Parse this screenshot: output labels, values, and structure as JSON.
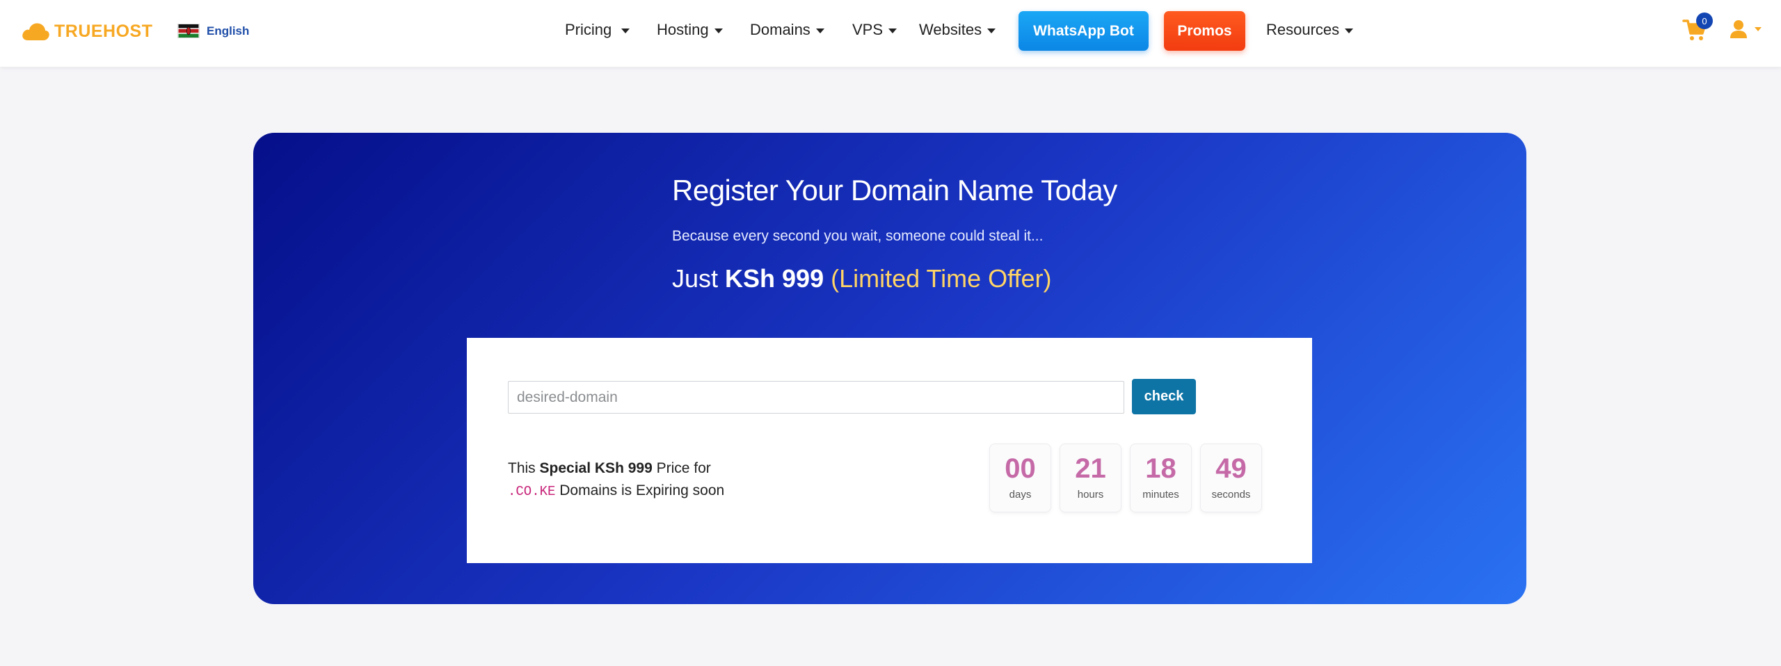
{
  "brand": {
    "name": "TRUEHOST",
    "accent": "#f7a823"
  },
  "language": {
    "label": "English"
  },
  "nav": {
    "pricing": "Pricing",
    "hosting": "Hosting",
    "domains": "Domains",
    "vps": "VPS",
    "websites": "Websites",
    "whatsapp": "WhatsApp Bot",
    "promos": "Promos",
    "resources": "Resources"
  },
  "cart": {
    "count": "0"
  },
  "hero": {
    "title": "Register Your Domain Name Today",
    "subtitle": "Because every second you wait, someone could steal it...",
    "offer_prefix": "Just ",
    "offer_price": "KSh 999",
    "offer_suffix": " (Limited Time Offer)"
  },
  "search": {
    "placeholder": "desired-domain",
    "button": "check"
  },
  "expiry": {
    "part1": "This ",
    "bold": "Special KSh 999",
    "part2": " Price for",
    "tld": ".CO.KE",
    "part3": " Domains is Expiring soon"
  },
  "countdown": [
    {
      "value": "00",
      "label": "days"
    },
    {
      "value": "21",
      "label": "hours"
    },
    {
      "value": "18",
      "label": "minutes"
    },
    {
      "value": "49",
      "label": "seconds"
    }
  ]
}
